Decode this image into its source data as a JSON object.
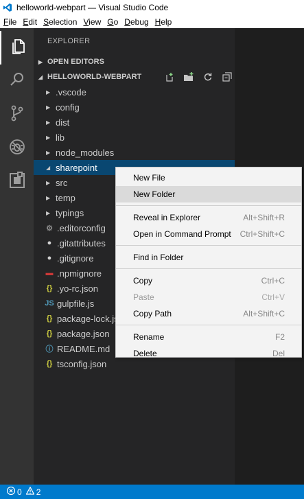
{
  "window": {
    "title": "helloworld-webpart — Visual Studio Code"
  },
  "menubar": [
    {
      "mnemonic": "F",
      "rest": "ile"
    },
    {
      "mnemonic": "E",
      "rest": "dit"
    },
    {
      "mnemonic": "S",
      "rest": "election"
    },
    {
      "mnemonic": "V",
      "rest": "iew"
    },
    {
      "mnemonic": "G",
      "rest": "o"
    },
    {
      "mnemonic": "D",
      "rest": "ebug"
    },
    {
      "mnemonic": "H",
      "rest": "elp"
    }
  ],
  "activity_bar": [
    "files-icon",
    "search-icon",
    "source-control-icon",
    "debug-icon",
    "extensions-icon"
  ],
  "explorer": {
    "title": "EXPLORER",
    "open_editors": "OPEN EDITORS",
    "project": "HELLOWORLD-WEBPART",
    "items": [
      {
        "label": ".vscode",
        "type": "folder",
        "expanded": false
      },
      {
        "label": "config",
        "type": "folder",
        "expanded": false
      },
      {
        "label": "dist",
        "type": "folder",
        "expanded": false
      },
      {
        "label": "lib",
        "type": "folder",
        "expanded": false
      },
      {
        "label": "node_modules",
        "type": "folder",
        "expanded": false
      },
      {
        "label": "sharepoint",
        "type": "folder",
        "expanded": true,
        "selected": true
      },
      {
        "label": "src",
        "type": "folder",
        "expanded": false
      },
      {
        "label": "temp",
        "type": "folder",
        "expanded": false
      },
      {
        "label": "typings",
        "type": "folder",
        "expanded": false
      },
      {
        "label": ".editorconfig",
        "type": "file",
        "icon": "gear-icon",
        "icon_glyph": "⚙",
        "icon_color": "#8c8c8c"
      },
      {
        "label": ".gitattributes",
        "type": "file",
        "icon": "github-icon",
        "icon_glyph": "●",
        "icon_color": "#d4d4d4"
      },
      {
        "label": ".gitignore",
        "type": "file",
        "icon": "github-icon",
        "icon_glyph": "●",
        "icon_color": "#d4d4d4"
      },
      {
        "label": ".npmignore",
        "type": "file",
        "icon": "npm-icon",
        "icon_glyph": "▬",
        "icon_color": "#cb3837"
      },
      {
        "label": ".yo-rc.json",
        "type": "file",
        "icon": "json-icon",
        "icon_glyph": "{}",
        "icon_color": "#cbcb41"
      },
      {
        "label": "gulpfile.js",
        "type": "file",
        "icon": "js-icon",
        "icon_glyph": "JS",
        "icon_color": "#519aba"
      },
      {
        "label": "package-lock.json",
        "type": "file",
        "icon": "json-icon",
        "icon_glyph": "{}",
        "icon_color": "#cbcb41"
      },
      {
        "label": "package.json",
        "type": "file",
        "icon": "json-icon",
        "icon_glyph": "{}",
        "icon_color": "#cbcb41"
      },
      {
        "label": "README.md",
        "type": "file",
        "icon": "info-icon",
        "icon_glyph": "ⓘ",
        "icon_color": "#519aba"
      },
      {
        "label": "tsconfig.json",
        "type": "file",
        "icon": "json-icon",
        "icon_glyph": "{}",
        "icon_color": "#cbcb41"
      }
    ]
  },
  "context_menu": {
    "groups": [
      [
        {
          "label": "New File",
          "key": ""
        },
        {
          "label": "New Folder",
          "key": "",
          "hover": true
        }
      ],
      [
        {
          "label": "Reveal in Explorer",
          "key": "Alt+Shift+R"
        },
        {
          "label": "Open in Command Prompt",
          "key": "Ctrl+Shift+C"
        }
      ],
      [
        {
          "label": "Find in Folder",
          "key": ""
        }
      ],
      [
        {
          "label": "Copy",
          "key": "Ctrl+C"
        },
        {
          "label": "Paste",
          "key": "Ctrl+V",
          "disabled": true
        },
        {
          "label": "Copy Path",
          "key": "Alt+Shift+C"
        }
      ],
      [
        {
          "label": "Rename",
          "key": "F2"
        },
        {
          "label": "Delete",
          "key": "Del"
        }
      ]
    ]
  },
  "statusbar": {
    "errors": "0",
    "warnings": "2"
  },
  "colors": {
    "accent": "#007acc",
    "selection": "#094771",
    "sidebar": "#252526",
    "activity": "#333333"
  }
}
